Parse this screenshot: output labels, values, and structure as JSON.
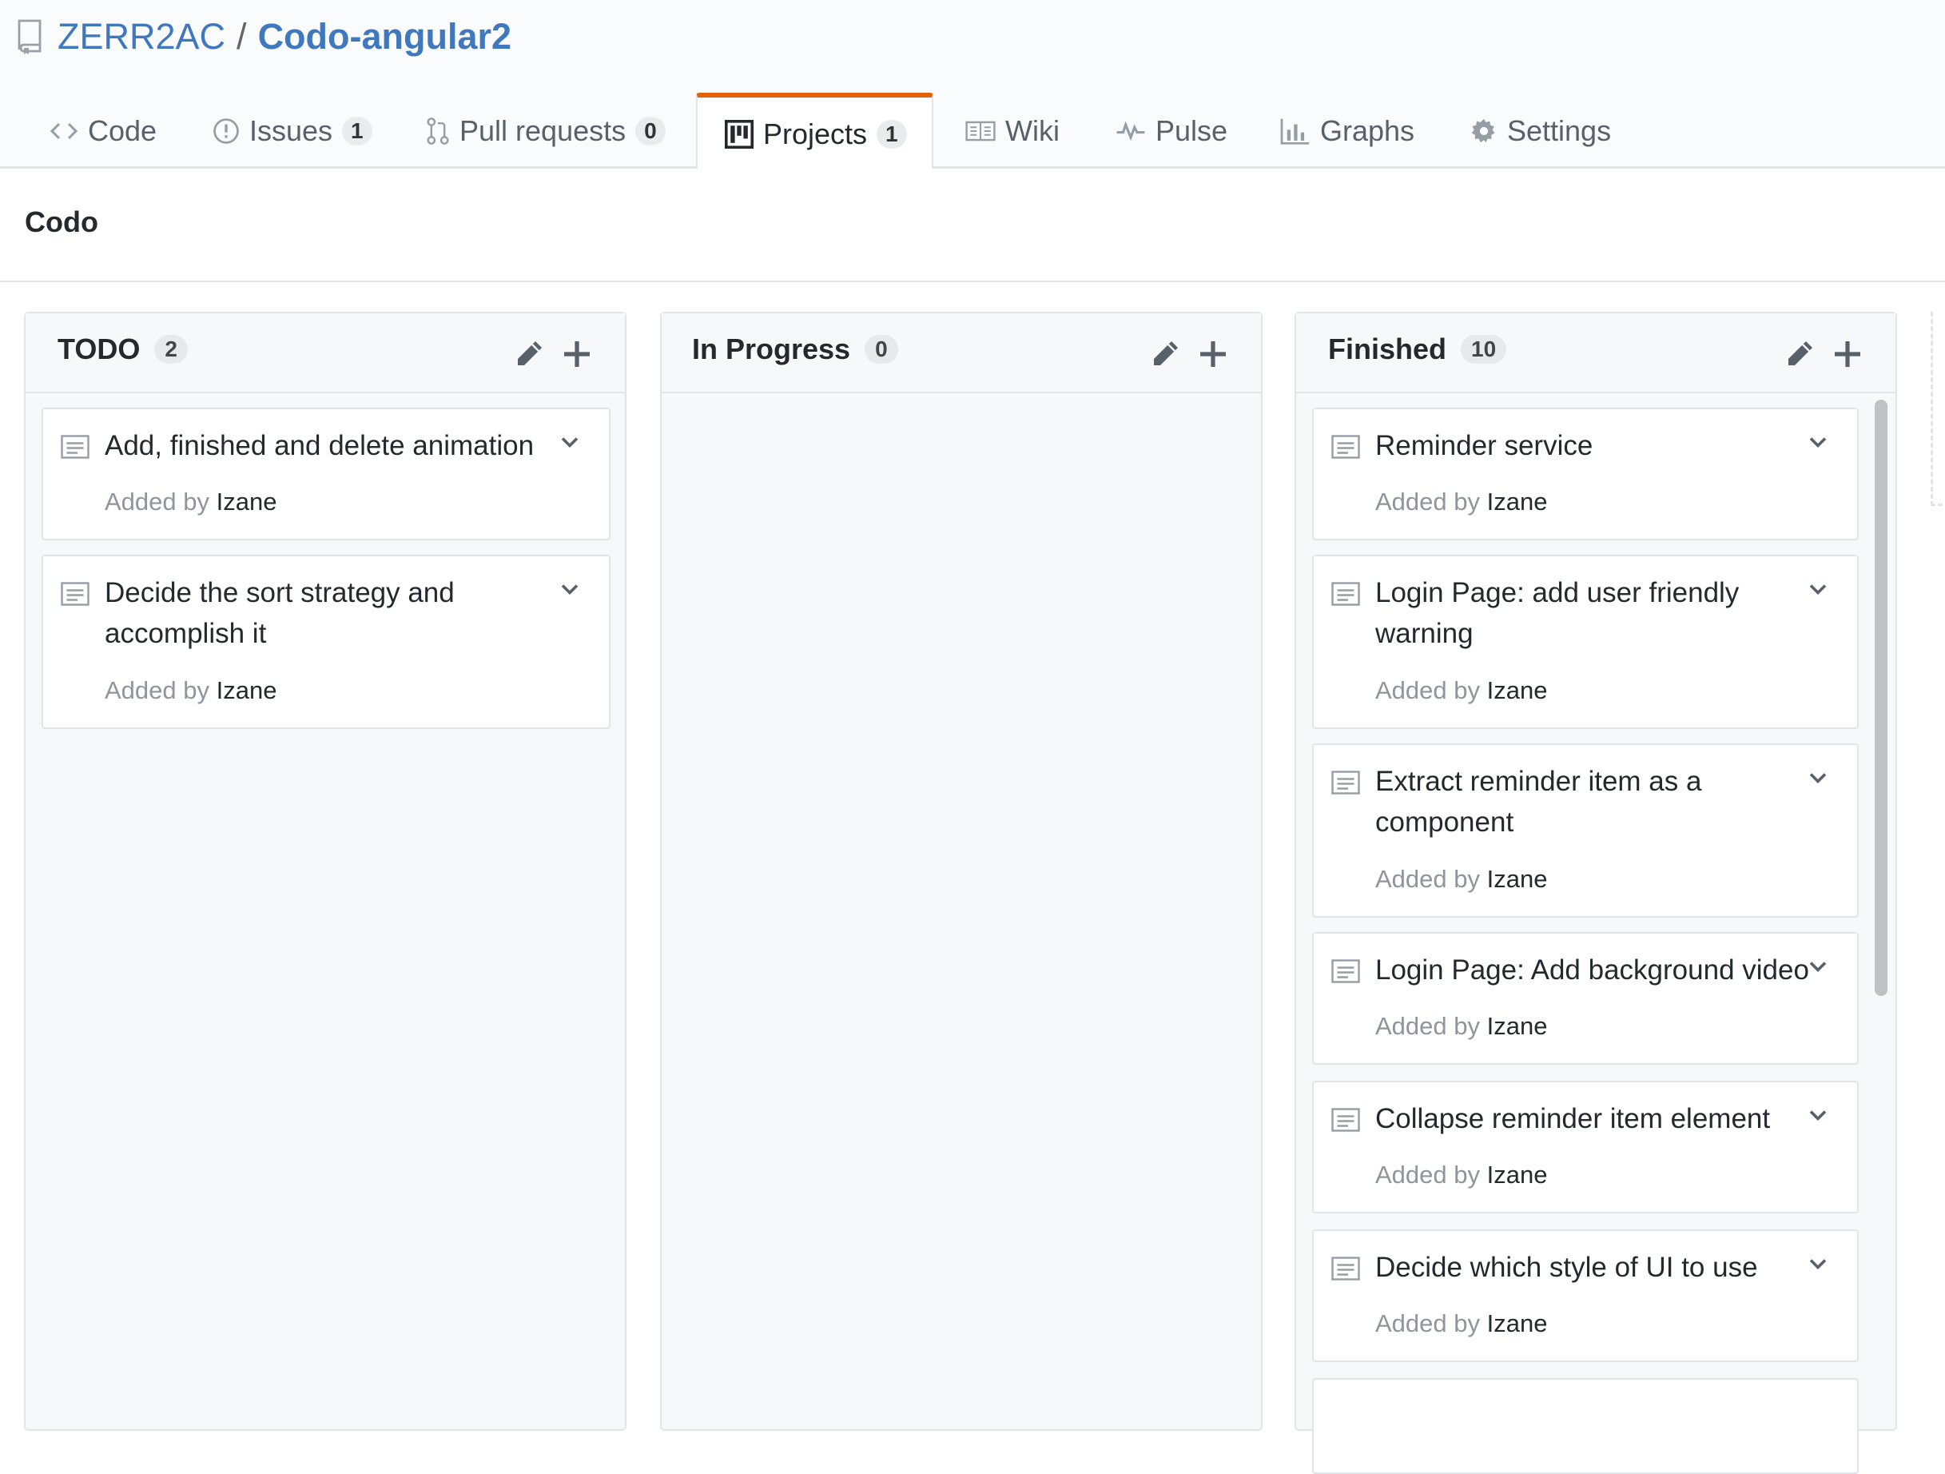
{
  "repo": {
    "owner": "ZERR2AC",
    "separator": "/",
    "name": "Codo-angular2"
  },
  "tabs": [
    {
      "label": "Code",
      "icon": "code-icon"
    },
    {
      "label": "Issues",
      "counter": "1",
      "icon": "issue-icon"
    },
    {
      "label": "Pull requests",
      "counter": "0",
      "icon": "pull-request-icon"
    },
    {
      "label": "Projects",
      "counter": "1",
      "icon": "project-icon",
      "selected": true
    },
    {
      "label": "Wiki",
      "icon": "book-icon"
    },
    {
      "label": "Pulse",
      "icon": "pulse-icon"
    },
    {
      "label": "Graphs",
      "icon": "graph-icon"
    },
    {
      "label": "Settings",
      "icon": "gear-icon"
    }
  ],
  "project": {
    "name": "Codo"
  },
  "columns": [
    {
      "title": "TODO",
      "count": "2",
      "cards": [
        {
          "title": "Add, finished and delete animation",
          "added_by": "Added by",
          "author": "Izane"
        },
        {
          "title": "Decide the sort strategy and accomplish it",
          "added_by": "Added by",
          "author": "Izane"
        }
      ]
    },
    {
      "title": "In Progress",
      "count": "0",
      "cards": []
    },
    {
      "title": "Finished",
      "count": "10",
      "cards": [
        {
          "title": "Reminder service",
          "added_by": "Added by",
          "author": "Izane"
        },
        {
          "title": "Login Page: add user friendly warning",
          "added_by": "Added by",
          "author": "Izane"
        },
        {
          "title": "Extract reminder item as a component",
          "added_by": "Added by",
          "author": "Izane"
        },
        {
          "title": "Login Page: Add background video",
          "added_by": "Added by",
          "author": "Izane"
        },
        {
          "title": "Collapse reminder item element",
          "added_by": "Added by",
          "author": "Izane"
        },
        {
          "title": "Decide which style of UI to use",
          "added_by": "Added by",
          "author": "Izane"
        }
      ]
    }
  ],
  "colors": {
    "accent": "#e36209",
    "link": "#4078c0",
    "border": "#e1e4e8",
    "column_bg": "#f6f8fa"
  }
}
